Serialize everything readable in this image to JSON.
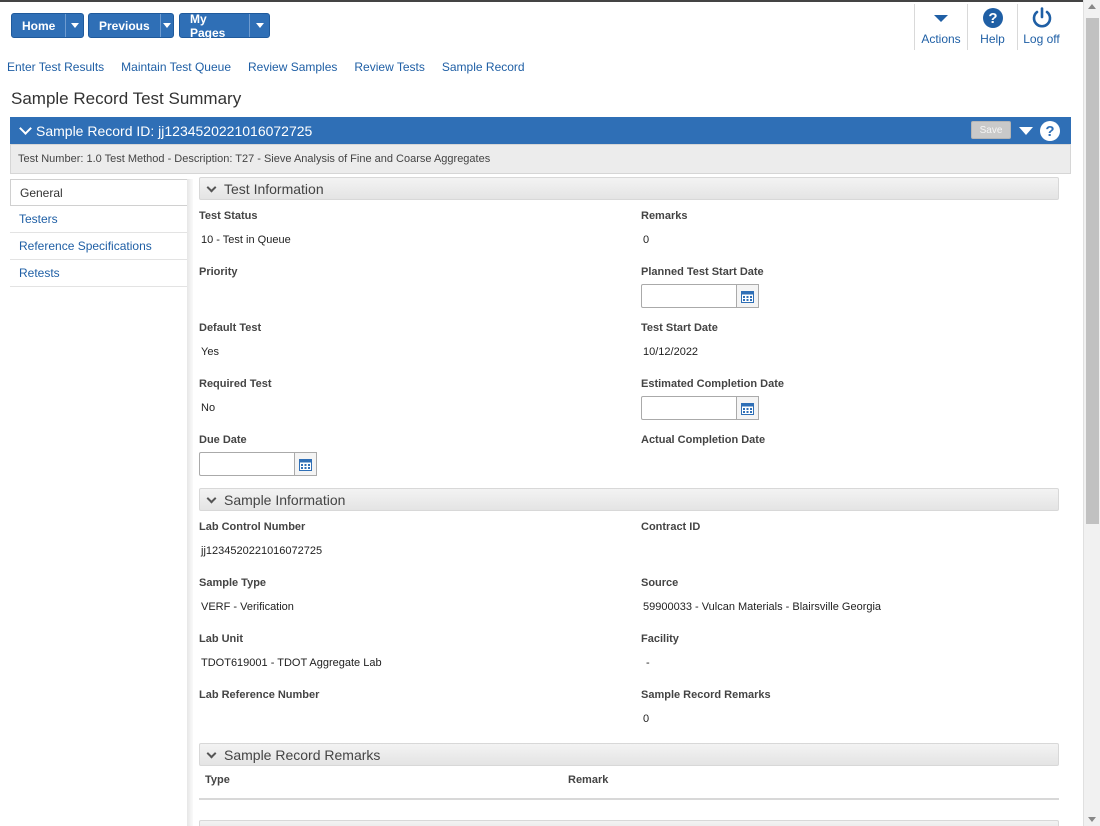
{
  "toolbar": {
    "home": "Home",
    "previous": "Previous",
    "my_pages": "My Pages",
    "actions": "Actions",
    "help": "Help",
    "logoff": "Log off"
  },
  "nav_links": [
    "Enter Test Results",
    "Maintain Test Queue",
    "Review Samples",
    "Review Tests",
    "Sample Record"
  ],
  "page_title": "Sample Record Test Summary",
  "record": {
    "title": "Sample Record ID: jj1234520221016072725",
    "save": "Save",
    "test_line": "Test Number: 1.0 Test Method - Description: T27 - Sieve Analysis of Fine and Coarse Aggregates"
  },
  "left_menu": [
    "General",
    "Testers",
    "Reference Specifications",
    "Retests"
  ],
  "test_info": {
    "header": "Test Information",
    "test_status_label": "Test Status",
    "test_status": "10 - Test in Queue",
    "remarks_label": "Remarks",
    "remarks": "0",
    "priority_label": "Priority",
    "planned_start_label": "Planned Test Start Date",
    "default_test_label": "Default Test",
    "default_test": "Yes",
    "test_start_label": "Test Start Date",
    "test_start": "10/12/2022",
    "required_test_label": "Required Test",
    "required_test": "No",
    "est_completion_label": "Estimated Completion Date",
    "due_date_label": "Due Date",
    "actual_completion_label": "Actual Completion Date"
  },
  "sample_info": {
    "header": "Sample Information",
    "lab_control_label": "Lab Control Number",
    "lab_control": "jj1234520221016072725",
    "contract_label": "Contract ID",
    "sample_type_label": "Sample Type",
    "sample_type": "VERF - Verification",
    "source_label": "Source",
    "source": "59900033 - Vulcan Materials - Blairsville Georgia",
    "lab_unit_label": "Lab Unit",
    "lab_unit": "TDOT619001 - TDOT Aggregate Lab",
    "facility_label": "Facility",
    "facility": "-",
    "lab_ref_label": "Lab Reference Number",
    "record_remarks_label": "Sample Record Remarks",
    "record_remarks": "0"
  },
  "remarks_section": {
    "header": "Sample Record Remarks",
    "col_type": "Type",
    "col_remark": "Remark"
  },
  "colors": {
    "primary": "#2f6fb6",
    "link": "#1f5fa5"
  }
}
